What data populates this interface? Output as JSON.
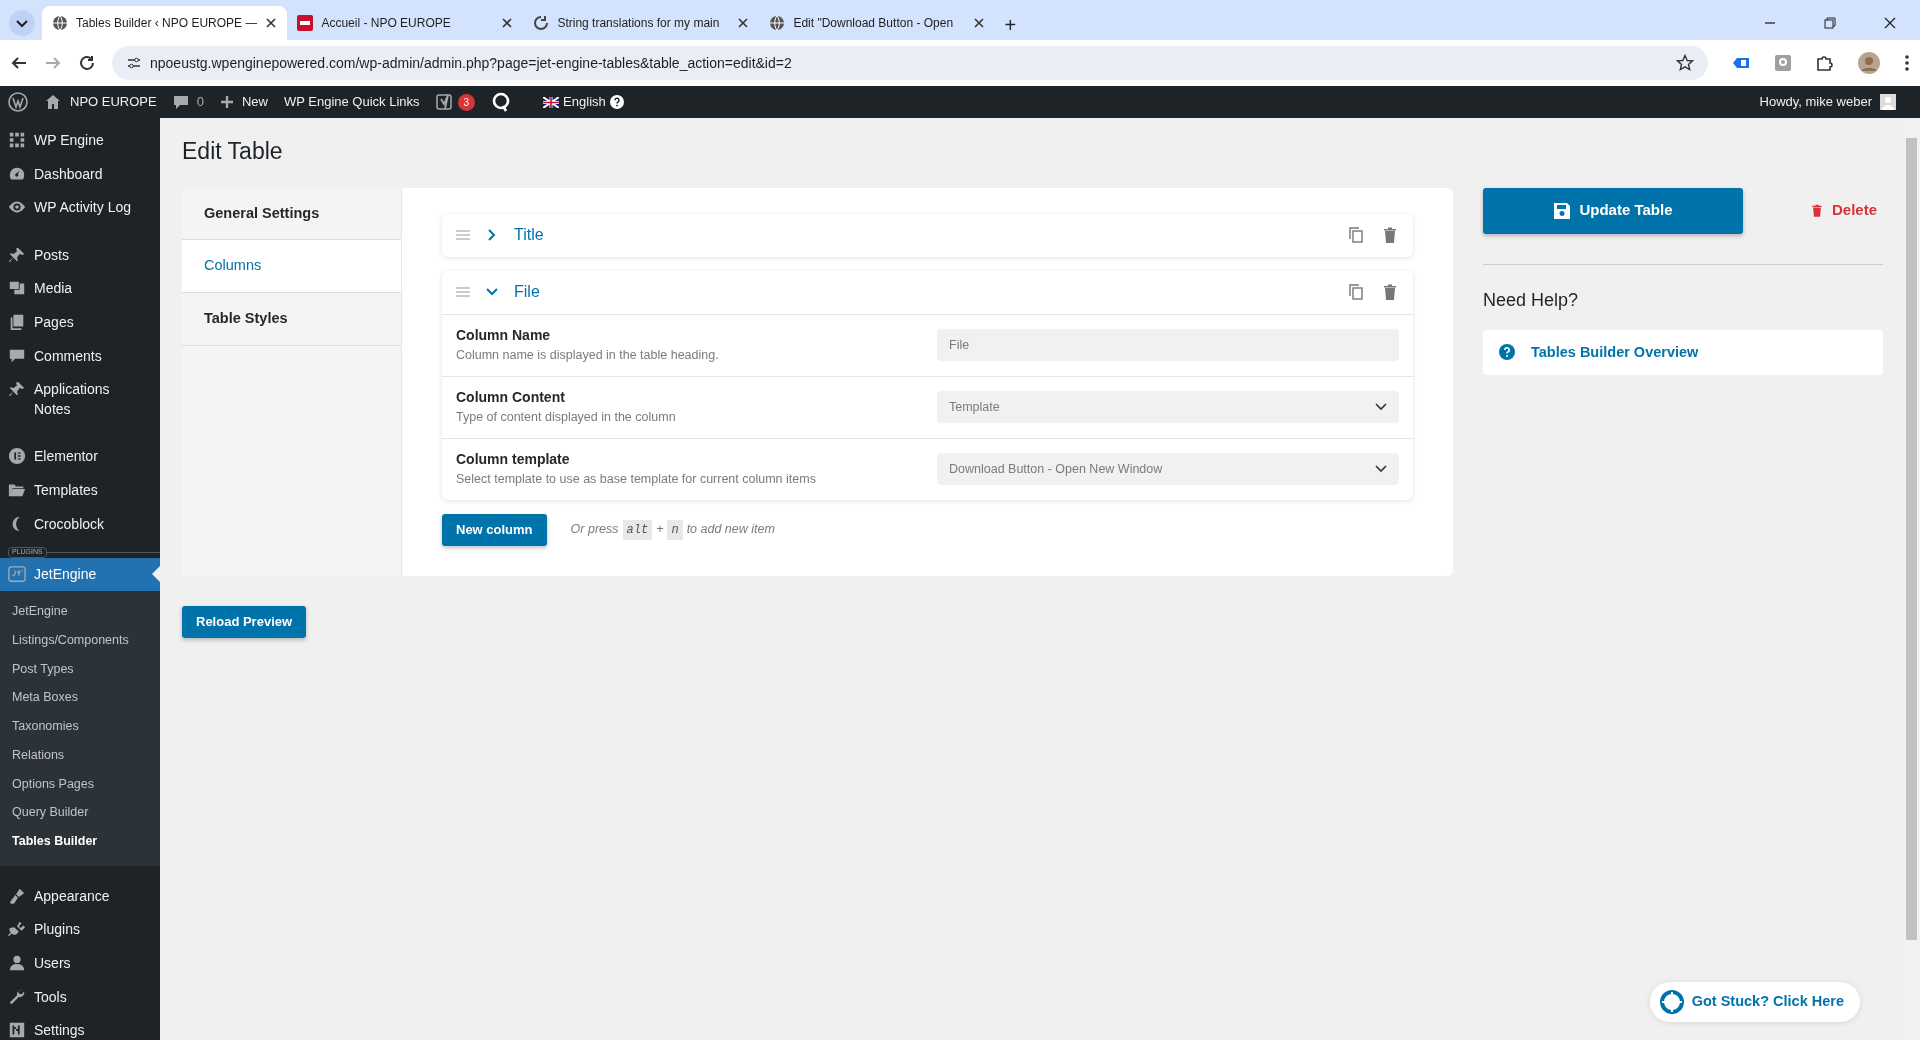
{
  "browser": {
    "tabs": [
      {
        "title": "Tables Builder ‹ NPO EUROPE —",
        "selected": true
      },
      {
        "title": "Accueil - NPO EUROPE",
        "selected": false
      },
      {
        "title": "String translations for my main",
        "selected": false
      },
      {
        "title": "Edit \"Download Button - Open",
        "selected": false
      }
    ],
    "new_tab": "+",
    "address": "npoeustg.wpenginepowered.com/wp-admin/admin.php?page=jet-engine-tables&table_action=edit&id=2"
  },
  "admin_bar": {
    "site": "NPO EUROPE",
    "comments": "0",
    "new": "New",
    "quick_links": "WP Engine Quick Links",
    "notifications": "3",
    "language": "English",
    "greeting": "Howdy, mike weber"
  },
  "sidebar": {
    "sections": [
      {
        "items": [
          {
            "label": "WP Engine",
            "selected": false
          },
          {
            "label": "Dashboard",
            "selected": false
          },
          {
            "label": "WP Activity Log",
            "selected": false
          }
        ]
      },
      {
        "items": [
          {
            "label": "Posts",
            "selected": false
          },
          {
            "label": "Media",
            "selected": false
          },
          {
            "label": "Pages",
            "selected": false
          },
          {
            "label": "Comments",
            "selected": false
          },
          {
            "label": "Applications Notes",
            "selected": false
          }
        ]
      },
      {
        "items": [
          {
            "label": "Elementor",
            "selected": false
          },
          {
            "label": "Templates",
            "selected": false
          },
          {
            "label": "Crocoblock",
            "selected": false
          }
        ]
      },
      {
        "label": "PLUGINS",
        "items": [
          {
            "label": "JetEngine",
            "selected": true,
            "children": [
              {
                "label": "JetEngine",
                "selected": false
              },
              {
                "label": "Listings/Components",
                "selected": false
              },
              {
                "label": "Post Types",
                "selected": false
              },
              {
                "label": "Meta Boxes",
                "selected": false
              },
              {
                "label": "Taxonomies",
                "selected": false
              },
              {
                "label": "Relations",
                "selected": false
              },
              {
                "label": "Options Pages",
                "selected": false
              },
              {
                "label": "Query Builder",
                "selected": false
              },
              {
                "label": "Tables Builder",
                "selected": true
              }
            ]
          }
        ]
      },
      {
        "items": [
          {
            "label": "Appearance",
            "selected": false
          },
          {
            "label": "Plugins",
            "selected": false
          },
          {
            "label": "Users",
            "selected": false
          },
          {
            "label": "Tools",
            "selected": false
          },
          {
            "label": "Settings",
            "selected": false
          }
        ]
      }
    ]
  },
  "page": {
    "title": "Edit Table",
    "settings_tabs": [
      {
        "label": "General Settings",
        "selected": false
      },
      {
        "label": "Columns",
        "selected": true
      },
      {
        "label": "Table Styles",
        "selected": false
      }
    ],
    "columns": [
      {
        "title": "Title",
        "expanded": false
      },
      {
        "title": "File",
        "expanded": true,
        "fields": [
          {
            "label": "Column Name",
            "description": "Column name is displayed in the table heading.",
            "kind": "text",
            "value": "File"
          },
          {
            "label": "Column Content",
            "description": "Type of content displayed in the column",
            "kind": "select",
            "value": "Template"
          },
          {
            "label": "Column template",
            "description": "Select template to use as base template for current column items",
            "kind": "select",
            "value": "Download Button - Open New Window"
          }
        ]
      }
    ],
    "new_column": "New column",
    "hint": {
      "prefix": "Or press",
      "keys": [
        "alt",
        "n"
      ],
      "joiner": "+",
      "suffix": "to add new item"
    },
    "update_button": "Update Table",
    "delete_link": "Delete",
    "help_heading": "Need Help?",
    "help_links": [
      "Tables Builder Overview"
    ],
    "reload_button": "Reload Preview",
    "help_pill": "Got Stuck? Click Here"
  }
}
